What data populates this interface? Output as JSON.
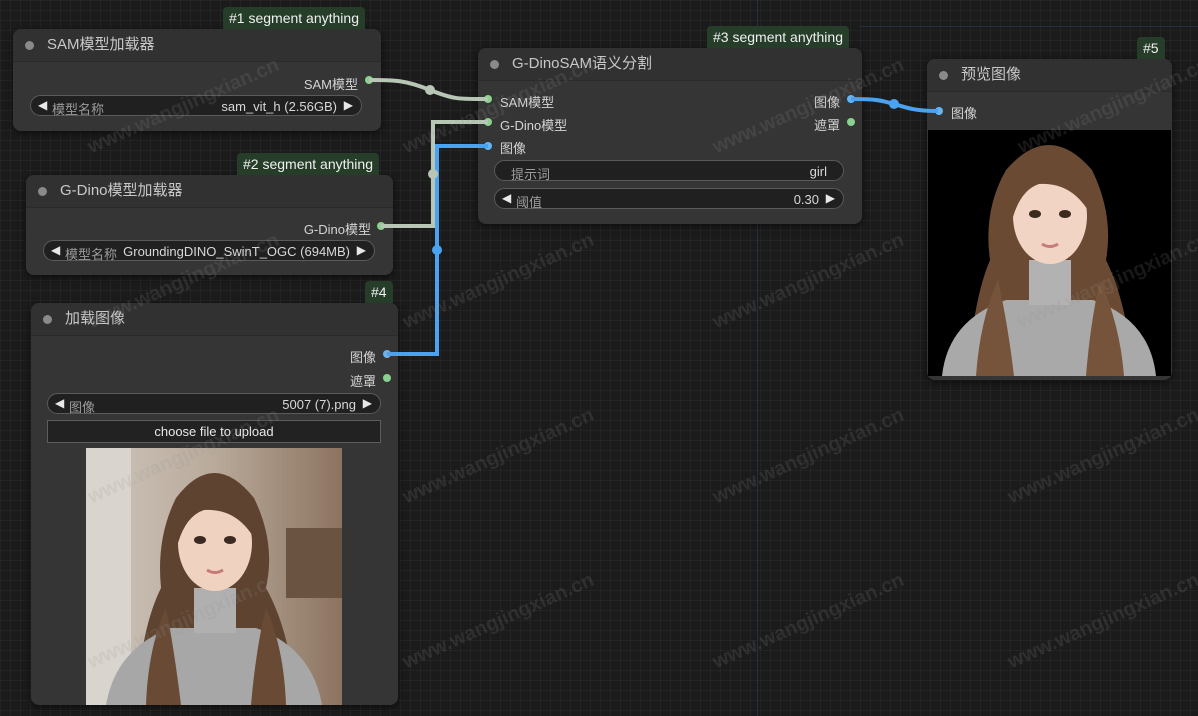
{
  "nodes": {
    "sam_loader": {
      "badge": "#1 segment anything",
      "title": "SAM模型加载器",
      "output": "SAM模型",
      "widget": {
        "label": "模型名称",
        "value": "sam_vit_h (2.56GB)"
      }
    },
    "gdino_loader": {
      "badge": "#2 segment anything",
      "title": "G-Dino模型加载器",
      "output": "G-Dino模型",
      "widget": {
        "label": "模型名称",
        "value": "GroundingDINO_SwinT_OGC (694MB)"
      }
    },
    "gdino_sam": {
      "badge": "#3 segment anything",
      "title": "G-DinoSAM语义分割",
      "inputs": [
        "SAM模型",
        "G-Dino模型",
        "图像"
      ],
      "outputs": [
        "图像",
        "遮罩"
      ],
      "prompt": {
        "label": "提示词",
        "value": "girl"
      },
      "threshold": {
        "label": "阈值",
        "value": "0.30"
      }
    },
    "load_image": {
      "badge": "#4",
      "title": "加载图像",
      "outputs": [
        "图像",
        "遮罩"
      ],
      "widget": {
        "label": "图像",
        "value": "5007 (7).png"
      },
      "upload_label": "choose file to upload"
    },
    "preview": {
      "badge": "#5",
      "title": "预览图像",
      "input": "图像"
    }
  },
  "watermark": "www.wangjingxian.cn",
  "colors": {
    "canvas": "#1b1b1b",
    "node_bg": "#353535",
    "badge_bg": "#253d29",
    "port_model": "#8ad18f",
    "port_image": "#64b5f6",
    "wire_model": "#b7c6b5",
    "wire_image": "#4aa3f0"
  }
}
